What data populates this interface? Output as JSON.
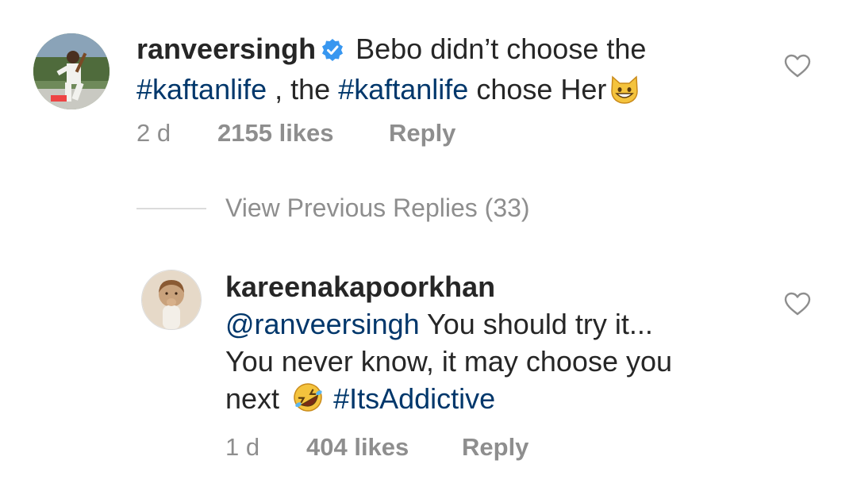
{
  "comment": {
    "username": "ranveersingh",
    "text_parts": [
      "Bebo didn’t choose the",
      "#kaftanlife",
      ", the",
      "#kaftanlife",
      "chose Her"
    ],
    "emoji_icon": "grinning-cat-emoji",
    "time": "2 d",
    "likes": "2155 likes",
    "reply_label": "Reply"
  },
  "view_previous_replies": "View Previous Replies (33)",
  "reply": {
    "username": "kareenakapoorkhan",
    "mention": "@ranveersingh",
    "text_line1": "You should try it...",
    "text_line2": "You never know, it may choose you",
    "text_line3": "next",
    "emoji_icon": "rolling-on-floor-laughing-emoji",
    "hashtag": "#ItsAddictive",
    "time": "1 d",
    "likes": "404 likes",
    "reply_label": "Reply"
  },
  "colors": {
    "text": "#262626",
    "hashtag": "#00376b",
    "muted": "#8e8e8e",
    "verified": "#3897f0"
  }
}
